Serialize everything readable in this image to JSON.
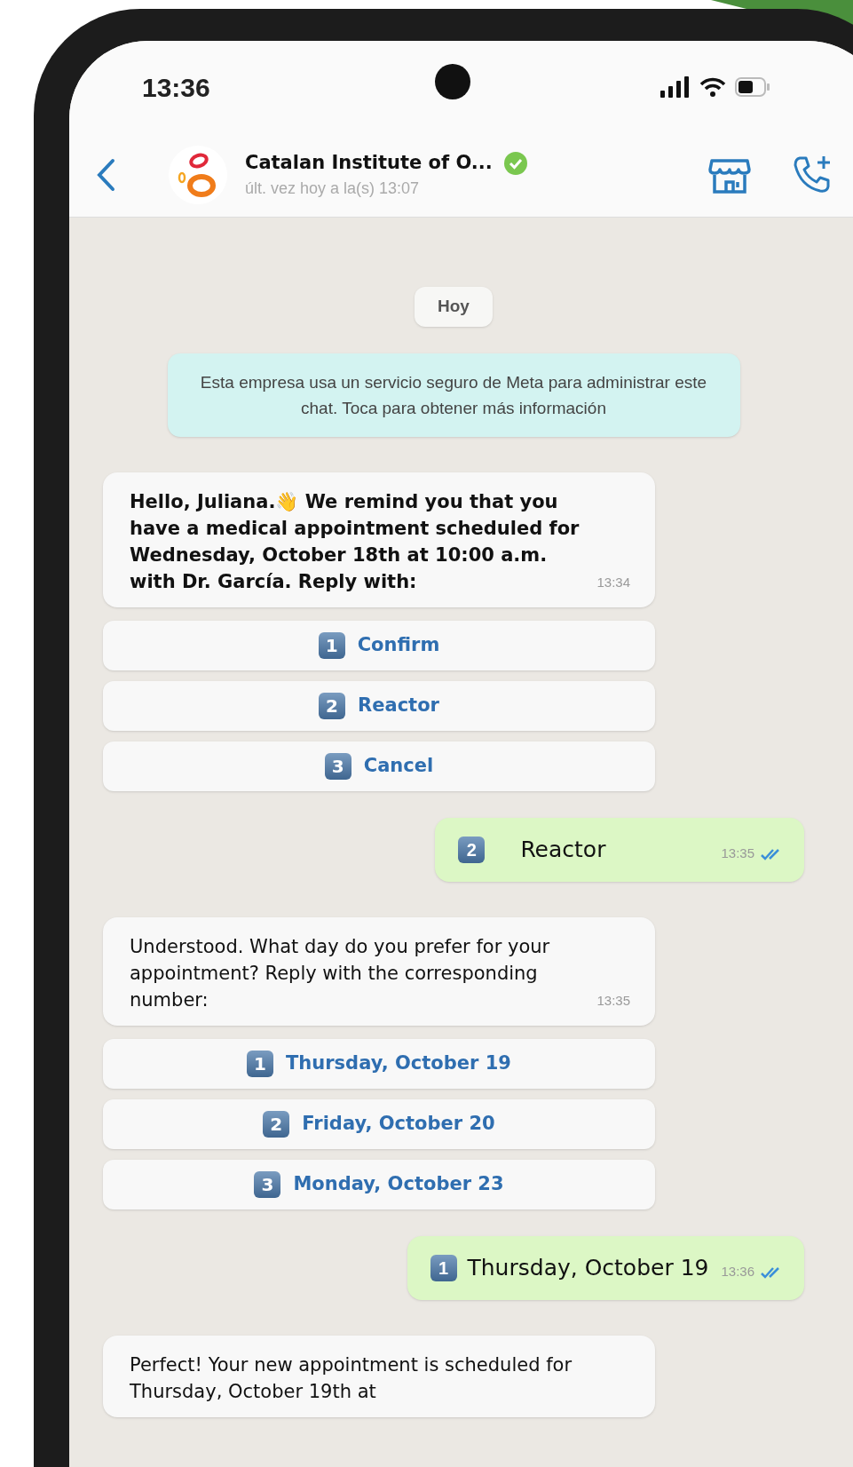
{
  "status_bar": {
    "time": "13:36"
  },
  "header": {
    "name": "Catalan Institute of O...",
    "verified": true,
    "last_seen": "últ. vez hoy a la(s) 13:07"
  },
  "date_chip": "Hoy",
  "system_notice": "Esta empresa usa un servicio seguro de Meta para administrar este chat. Toca para obtener más información",
  "messages": [
    {
      "kind": "incoming",
      "bold": true,
      "text": "Hello, Juliana.👋  We remind you that you have a medical appointment scheduled for Wednesday, October 18th at 10:00 a.m. with Dr. García. Reply with:",
      "time": "13:34",
      "options": [
        {
          "key": "1",
          "label": "Confirm"
        },
        {
          "key": "2",
          "label": "Reactor"
        },
        {
          "key": "3",
          "label": "Cancel"
        }
      ]
    },
    {
      "kind": "outgoing",
      "key": "2",
      "text": "Reactor",
      "time": "13:35",
      "read": true
    },
    {
      "kind": "incoming",
      "bold": false,
      "text": "Understood. What day do you prefer for your appointment? Reply with the corresponding number:",
      "time": "13:35",
      "options": [
        {
          "key": "1",
          "label": "Thursday, October 19"
        },
        {
          "key": "2",
          "label": "Friday, October 20"
        },
        {
          "key": "3",
          "label": "Monday, October 23"
        }
      ]
    },
    {
      "kind": "outgoing",
      "key": "1",
      "text": "Thursday, October 19",
      "time": "13:36",
      "read": true
    },
    {
      "kind": "incoming",
      "bold": false,
      "text": "Perfect! Your new appointment is scheduled for Thursday, October 19th at"
    }
  ]
}
